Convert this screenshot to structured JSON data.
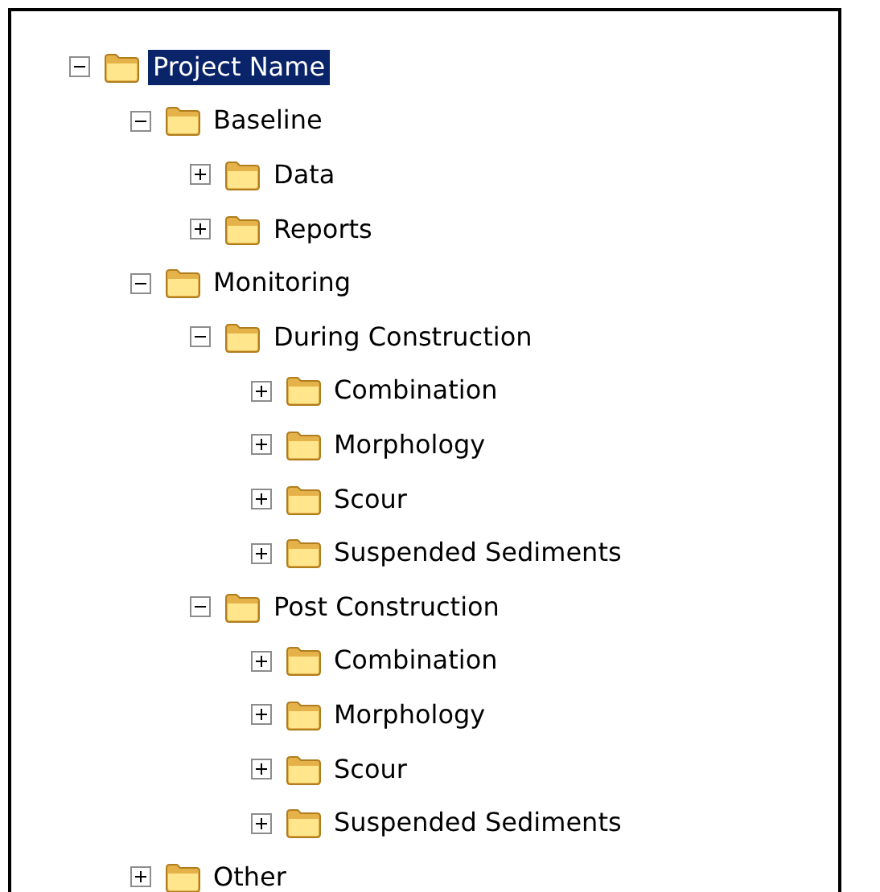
{
  "tree": [
    {
      "label": "Project Name",
      "expanded": true,
      "selected": true,
      "children": [
        {
          "label": "Baseline",
          "expanded": true,
          "selected": false,
          "children": [
            {
              "label": "Data",
              "expanded": false,
              "selected": false
            },
            {
              "label": "Reports",
              "expanded": false,
              "selected": false
            }
          ]
        },
        {
          "label": "Monitoring",
          "expanded": true,
          "selected": false,
          "children": [
            {
              "label": "During Construction",
              "expanded": true,
              "selected": false,
              "children": [
                {
                  "label": "Combination",
                  "expanded": false,
                  "selected": false
                },
                {
                  "label": "Morphology",
                  "expanded": false,
                  "selected": false
                },
                {
                  "label": "Scour",
                  "expanded": false,
                  "selected": false
                },
                {
                  "label": "Suspended Sediments",
                  "expanded": false,
                  "selected": false
                }
              ]
            },
            {
              "label": "Post Construction",
              "expanded": true,
              "selected": false,
              "children": [
                {
                  "label": "Combination",
                  "expanded": false,
                  "selected": false
                },
                {
                  "label": "Morphology",
                  "expanded": false,
                  "selected": false
                },
                {
                  "label": "Scour",
                  "expanded": false,
                  "selected": false
                },
                {
                  "label": "Suspended Sediments",
                  "expanded": false,
                  "selected": false
                }
              ]
            }
          ]
        },
        {
          "label": "Other",
          "expanded": false,
          "selected": false
        }
      ]
    }
  ]
}
